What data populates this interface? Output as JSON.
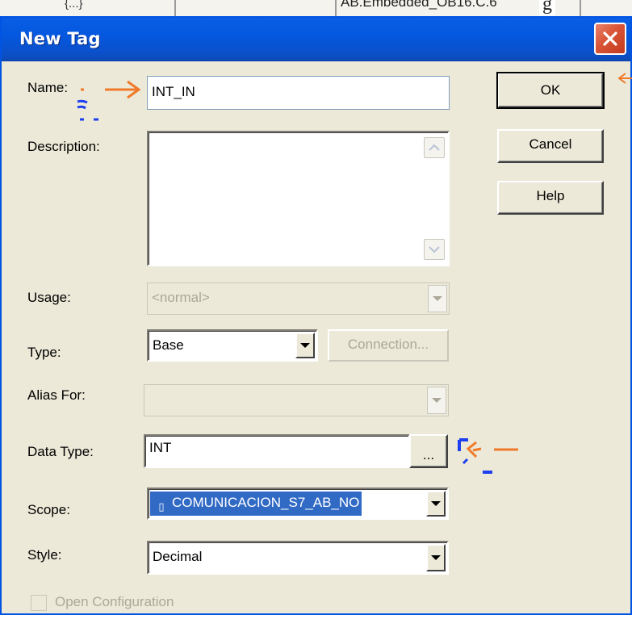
{
  "background": {
    "cell_left": "{...}",
    "cell_right": "AB.Embedded_OB16.C.6",
    "cell_extra": "g"
  },
  "dialog": {
    "title": "New Tag",
    "close_icon": "close-icon"
  },
  "form": {
    "name_label": "Name:",
    "name_value": "INT_IN",
    "description_label": "Description:",
    "description_value": "",
    "usage_label": "Usage:",
    "usage_value": "<normal>",
    "type_label": "Type:",
    "type_value": "Base",
    "connection_label": "Connection...",
    "alias_label": "Alias For:",
    "alias_value": "",
    "datatype_label": "Data Type:",
    "datatype_value": "INT",
    "datatype_browse": "...",
    "scope_label": "Scope:",
    "scope_value": "COMUNICACION_S7_AB_NO",
    "style_label": "Style:",
    "style_value": "Decimal",
    "open_config_label": "Open Configuration"
  },
  "buttons": {
    "ok": "OK",
    "cancel": "Cancel",
    "help": "Help"
  },
  "colors": {
    "title_bar": "#0458df",
    "dialog_bg": "#ece9d8",
    "annotation_arrow": "#f07a2a",
    "annotation_scribble": "#1d3ff0",
    "selection": "#316ac5"
  }
}
